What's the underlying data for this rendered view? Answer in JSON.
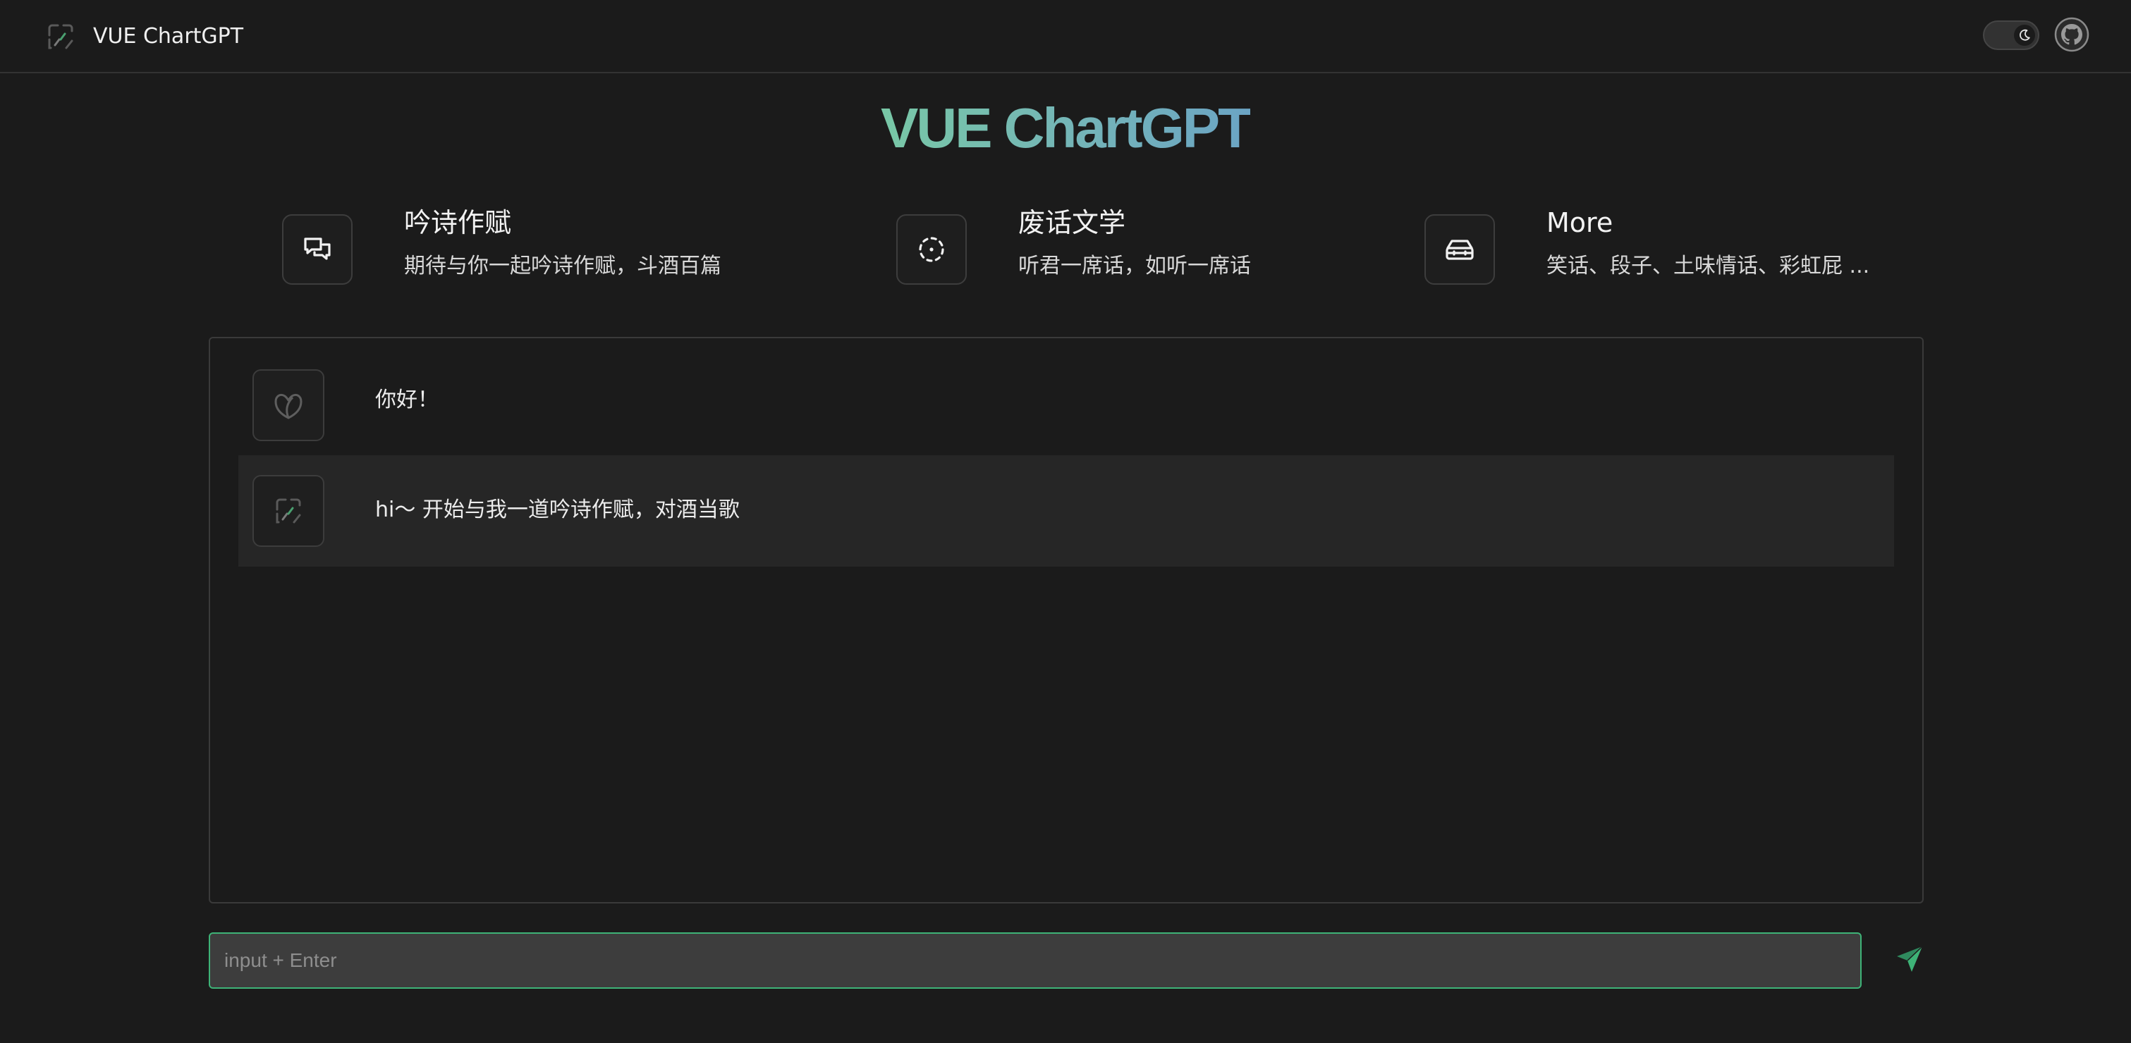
{
  "header": {
    "app_title": "VUE ChartGPT",
    "logo_icon": "gpt-logo-icon",
    "theme_toggle_icon": "moon-icon",
    "github_icon": "github-icon"
  },
  "hero": {
    "title": "VUE ChartGPT",
    "gradient_colors": [
      "#78c7a6",
      "#6ba4c4"
    ]
  },
  "features": [
    {
      "icon": "chat-bubbles-icon",
      "title": "吟诗作赋",
      "description": "期待与你一起吟诗作赋，斗酒百篇"
    },
    {
      "icon": "focus-target-icon",
      "title": "废话文学",
      "description": "听君一席话，如听一席话"
    },
    {
      "icon": "toolbox-icon",
      "title": "More",
      "description": "笑话、段子、土味情话、彩虹屁 ..."
    }
  ],
  "chat": {
    "messages": [
      {
        "role": "user",
        "avatar_icon": "user-avatar-icon",
        "text": "你好！"
      },
      {
        "role": "assistant",
        "avatar_icon": "gpt-logo-icon",
        "text": "hi～ 开始与我一道吟诗作赋，对酒当歌"
      }
    ]
  },
  "input": {
    "value": "",
    "placeholder": "input + Enter",
    "send_icon": "send-icon"
  },
  "colors": {
    "background": "#1b1b1b",
    "accent": "#3eb377",
    "panel_border": "#3a3a3a"
  }
}
